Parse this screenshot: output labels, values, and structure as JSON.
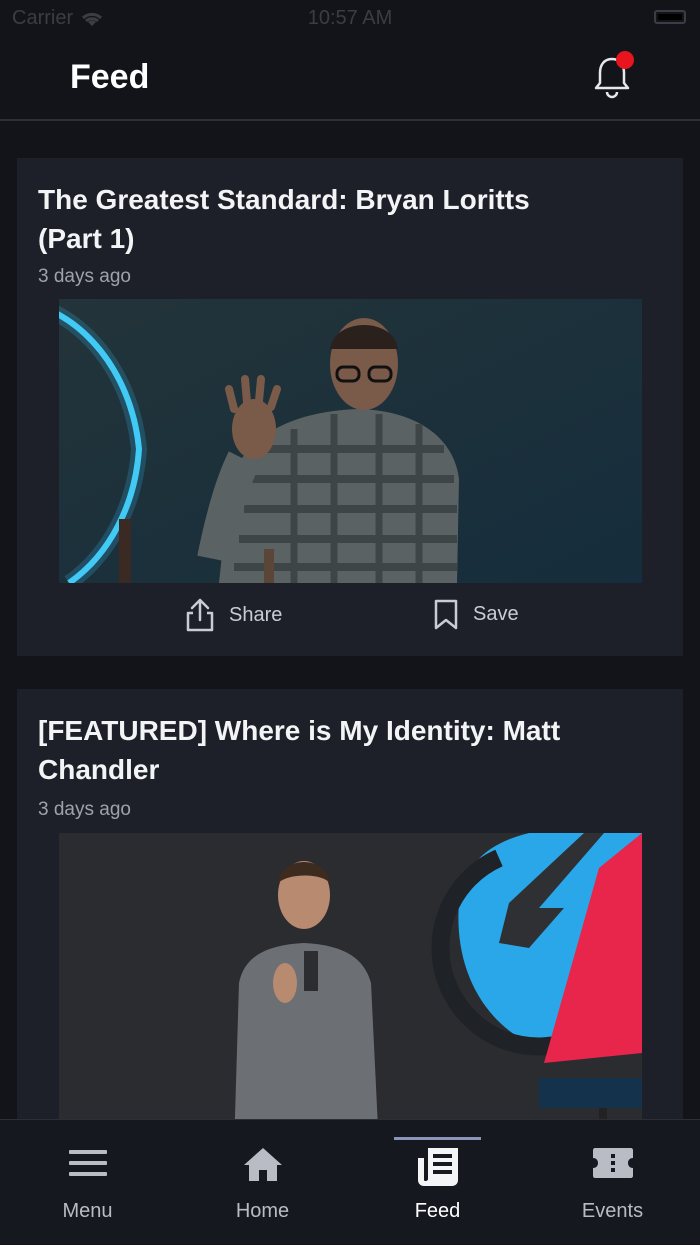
{
  "status_bar": {
    "carrier": "Carrier",
    "time": "10:57 AM"
  },
  "header": {
    "title": "Feed",
    "notification_icon": "bell-icon",
    "has_unread": true
  },
  "feed": [
    {
      "title": "The Greatest Standard: Bryan Loritts (Part 1)",
      "time": "3 days ago",
      "actions": {
        "share_label": "Share",
        "save_label": "Save"
      }
    },
    {
      "title": "[FEATURED] Where is My Identity: Matt Chandler",
      "time": "3 days ago"
    }
  ],
  "tabs": [
    {
      "label": "Menu",
      "icon": "menu-icon"
    },
    {
      "label": "Home",
      "icon": "home-icon"
    },
    {
      "label": "Feed",
      "icon": "feed-icon",
      "active": true
    },
    {
      "label": "Events",
      "icon": "ticket-icon"
    }
  ],
  "colors": {
    "background": "#12141a",
    "card": "#1e2029",
    "badge": "#e8141e",
    "tab_indicator": "#8c93b8"
  }
}
